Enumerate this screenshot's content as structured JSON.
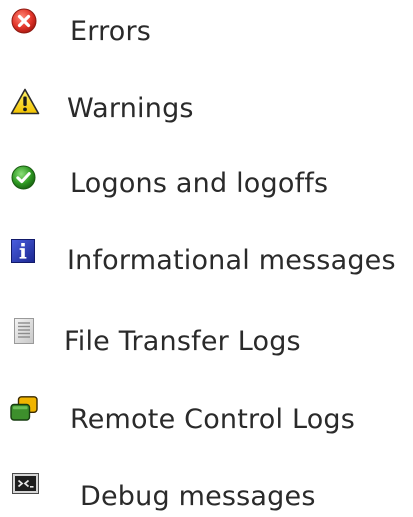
{
  "legend": {
    "items": [
      {
        "label": "Errors",
        "icon": "error-icon",
        "color": "#e2352a"
      },
      {
        "label": "Warnings",
        "icon": "warning-icon",
        "color": "#f5d000"
      },
      {
        "label": "Logons and logoffs",
        "icon": "checkmark-icon",
        "color": "#2f9a23"
      },
      {
        "label": "Informational messages",
        "icon": "info-icon",
        "color": "#1f2fb8"
      },
      {
        "label": "File Transfer Logs",
        "icon": "document-icon",
        "color": "#b9b9b9"
      },
      {
        "label": "Remote Control Logs",
        "icon": "remote-windows-icon",
        "color": "#3d8f2c"
      },
      {
        "label": "Debug messages",
        "icon": "console-icon",
        "color": "#262626"
      }
    ]
  }
}
